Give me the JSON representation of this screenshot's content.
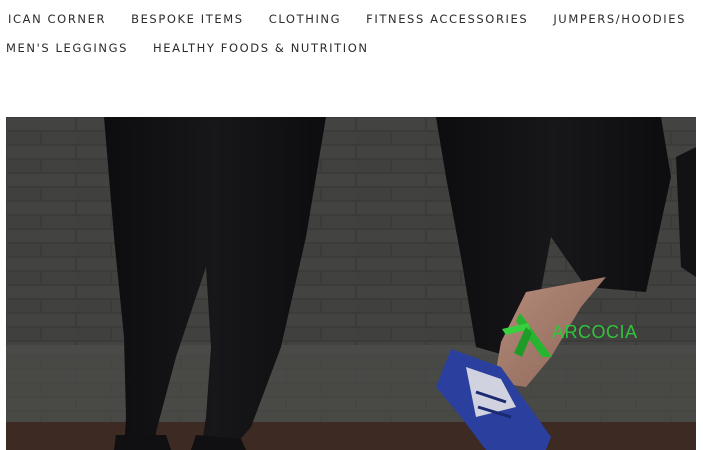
{
  "nav": {
    "row1": [
      {
        "label": "ICAN CORNER"
      },
      {
        "label": "BESPOKE ITEMS"
      },
      {
        "label": "CLOTHING"
      },
      {
        "label": "FITNESS ACCESSORIES"
      },
      {
        "label": "JUMPERS/HOODIES"
      }
    ],
    "row2": [
      {
        "label": "MEN'S LEGGINGS"
      },
      {
        "label": "HEALTHY FOODS & NUTRITION"
      }
    ]
  },
  "hero": {
    "logo_text": "ARCOCIA",
    "logo_color": "#31c43a"
  }
}
